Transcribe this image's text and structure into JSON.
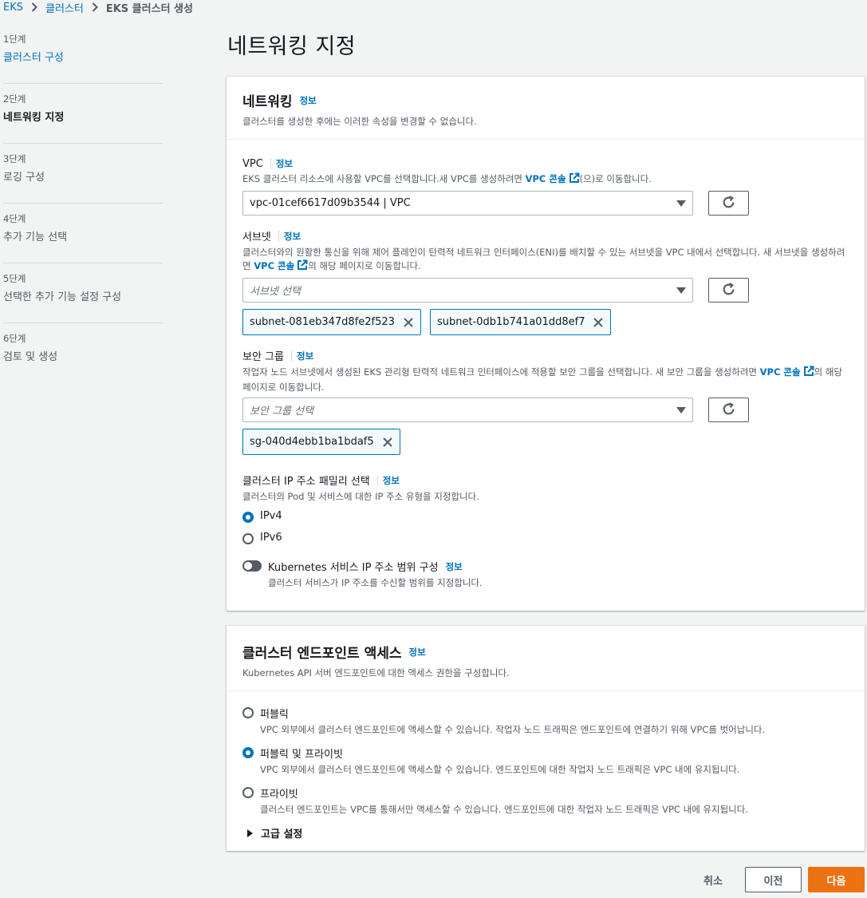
{
  "breadcrumb": {
    "items": [
      "EKS",
      "클러스터"
    ],
    "current": "EKS 클러스터 생성"
  },
  "steps": [
    {
      "num": "1단계",
      "label": "클러스터 구성"
    },
    {
      "num": "2단계",
      "label": "네트워킹 지정"
    },
    {
      "num": "3단계",
      "label": "로깅 구성"
    },
    {
      "num": "4단계",
      "label": "추가 기능 선택"
    },
    {
      "num": "5단계",
      "label": "선택한 추가 기능 설정 구성"
    },
    {
      "num": "6단계",
      "label": "검토 및 생성"
    }
  ],
  "page_title": "네트워킹 지정",
  "info_label": "정보",
  "networking": {
    "title": "네트워킹",
    "desc": "클러스터를 생성한 후에는 이러한 속성을 변경할 수 없습니다.",
    "vpc": {
      "label": "VPC",
      "desc_before": "EKS 클러스터 리소스에 사용할 VPC를 선택합니다.새 VPC를 생성하려면 ",
      "desc_link": "VPC 콘솔",
      "desc_after": "(으)로 이동합니다.",
      "value": "vpc-01cef6617d09b3544 | VPC"
    },
    "subnet": {
      "label": "서브넷",
      "desc_before": "클러스터와의 원활한 통신을 위해 제어 플레인이 탄력적 네트워크 인터페이스(ENI)를 배치할 수 있는 서브넷을 VPC 내에서 선택합니다. 새 서브넷을 생성하려면 ",
      "desc_link": "VPC 콘솔",
      "desc_after": "의 해당 페이지로 이동합니다.",
      "placeholder": "서브넷 선택",
      "tokens": [
        "subnet-081eb347d8fe2f523",
        "subnet-0db1b741a01dd8ef7"
      ]
    },
    "sg": {
      "label": "보안 그룹",
      "desc_before": "작업자 노드 서브넷에서 생성된 EKS 관리형 탄력적 네트워크 인터페이스에 적용할 보안 그룹을 선택합니다. 새 보안 그룹을 생성하려면 ",
      "desc_link": "VPC 콘솔",
      "desc_after": "의 해당 페이지로 이동합니다.",
      "placeholder": "보안 그룹 선택",
      "tokens": [
        "sg-040d4ebb1ba1bdaf5"
      ]
    },
    "ip_family": {
      "label": "클러스터 IP 주소 패밀리 선택",
      "desc": "클러스터의 Pod 및 서비스에 대한 IP 주소 유형을 지정합니다.",
      "options": [
        "IPv4",
        "IPv6"
      ],
      "selected": "IPv4"
    },
    "k8s_range": {
      "label": "Kubernetes 서비스 IP 주소 범위 구성",
      "desc": "클러스터 서비스가 IP 주소를 수신할 범위를 지정합니다.",
      "enabled": false
    }
  },
  "endpoint": {
    "title": "클러스터 엔드포인트 액세스",
    "desc": "Kubernetes API 서버 엔드포인트에 대한 액세스 권한을 구성합니다.",
    "options": [
      {
        "label": "퍼블릭",
        "desc": "VPC 외부에서 클러스터 엔드포인트에 액세스할 수 있습니다. 작업자 노드 트래픽은 엔드포인트에 연결하기 위해 VPC를 벗어납니다."
      },
      {
        "label": "퍼블릭 및 프라이빗",
        "desc": "VPC 외부에서 클러스터 엔드포인트에 액세스할 수 있습니다. 엔드포인트에 대한 작업자 노드 트래픽은 VPC 내에 유지됩니다."
      },
      {
        "label": "프라이빗",
        "desc": "클러스터 엔드포인트는 VPC를 통해서만 액세스할 수 있습니다. 엔드포인트에 대한 작업자 노드 트래픽은 VPC 내에 유지됩니다."
      }
    ],
    "selected": "퍼블릭 및 프라이빗",
    "advanced": "고급 설정"
  },
  "footer": {
    "cancel": "취소",
    "previous": "이전",
    "next": "다음"
  },
  "colors": {
    "link": "#0073bb",
    "primary": "#ec7211",
    "text": "#16191f",
    "muted": "#545b64"
  }
}
